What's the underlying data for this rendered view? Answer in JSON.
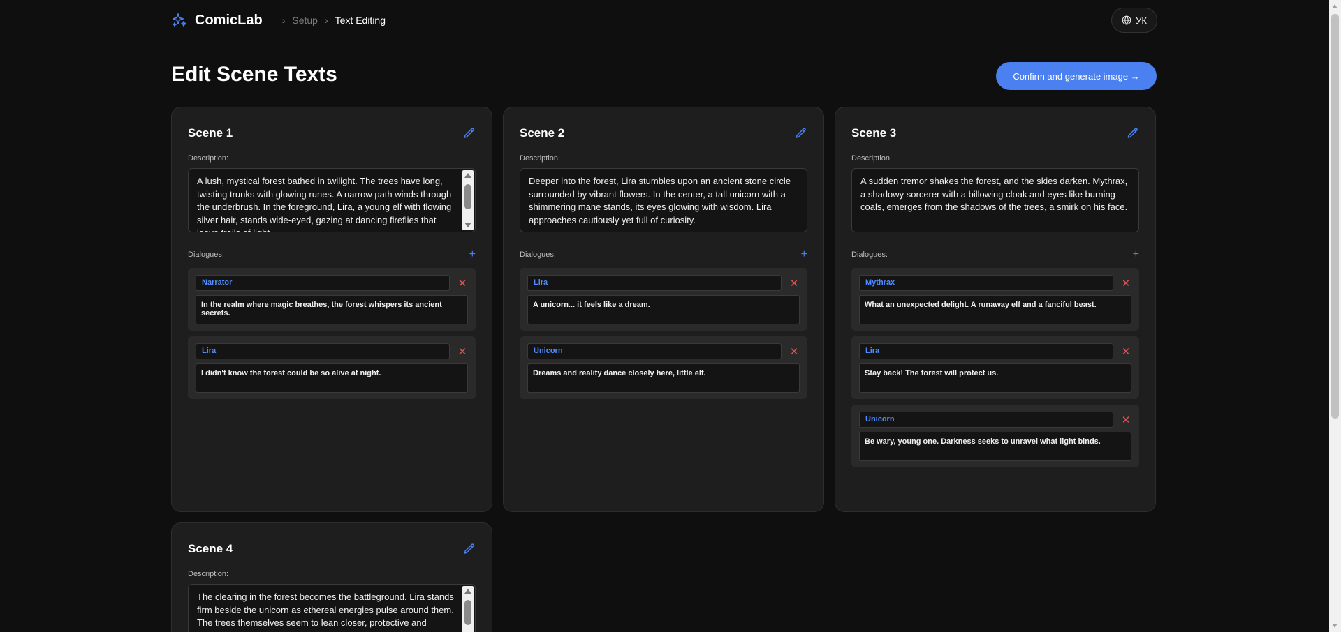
{
  "topbar": {
    "brand": "ComicLab",
    "breadcrumb": [
      "Setup",
      "Text Editing"
    ],
    "language": "УК"
  },
  "main": {
    "title": "Edit Scene Texts",
    "confirm_label": "Confirm and generate image →",
    "description_label": "Description:",
    "dialogues_label": "Dialogues:"
  },
  "scenes": [
    {
      "title": "Scene 1",
      "description": "A lush, mystical forest bathed in twilight. The trees have long, twisting trunks with glowing runes. A narrow path winds through the underbrush. In the foreground, Lira, a young elf with flowing silver hair, stands wide-eyed, gazing at dancing fireflies that leave trails of light.",
      "scrollable": true,
      "dialogues": [
        {
          "speaker": "Narrator",
          "text": "In the realm where magic breathes, the forest whispers its ancient secrets."
        },
        {
          "speaker": "Lira",
          "text": "I didn't know the forest could be so alive at night."
        }
      ]
    },
    {
      "title": "Scene 2",
      "description": "Deeper into the forest, Lira stumbles upon an ancient stone circle surrounded by vibrant flowers. In the center, a tall unicorn with a shimmering mane stands, its eyes glowing with wisdom. Lira approaches cautiously yet full of curiosity.",
      "scrollable": false,
      "dialogues": [
        {
          "speaker": "Lira",
          "text": "A unicorn... it feels like a dream."
        },
        {
          "speaker": "Unicorn",
          "text": "Dreams and reality dance closely here, little elf."
        }
      ]
    },
    {
      "title": "Scene 3",
      "description": "A sudden tremor shakes the forest, and the skies darken. Mythrax, a shadowy sorcerer with a billowing cloak and eyes like burning coals, emerges from the shadows of the trees, a smirk on his face.",
      "scrollable": false,
      "dialogues": [
        {
          "speaker": "Mythrax",
          "text": "What an unexpected delight. A runaway elf and a fanciful beast."
        },
        {
          "speaker": "Lira",
          "text": "Stay back! The forest will protect us."
        },
        {
          "speaker": "Unicorn",
          "text": "Be wary, young one. Darkness seeks to unravel what light binds."
        }
      ]
    },
    {
      "title": "Scene 4",
      "description": "The clearing in the forest becomes the battleground. Lira stands firm beside the unicorn as ethereal energies pulse around them. The trees themselves seem to lean closer, protective and shielding them while Mythrax raises his hands.",
      "scrollable": true,
      "dialogues": []
    }
  ],
  "icons": {
    "logo": "sparkles-icon",
    "edit": "pencil-icon",
    "add": "plus-icon",
    "remove": "close-icon",
    "language": "globe-icon"
  },
  "colors": {
    "accent": "#4a80f0",
    "danger": "#e05252",
    "background": "#0f0f0f",
    "card": "#1e1e1e"
  }
}
